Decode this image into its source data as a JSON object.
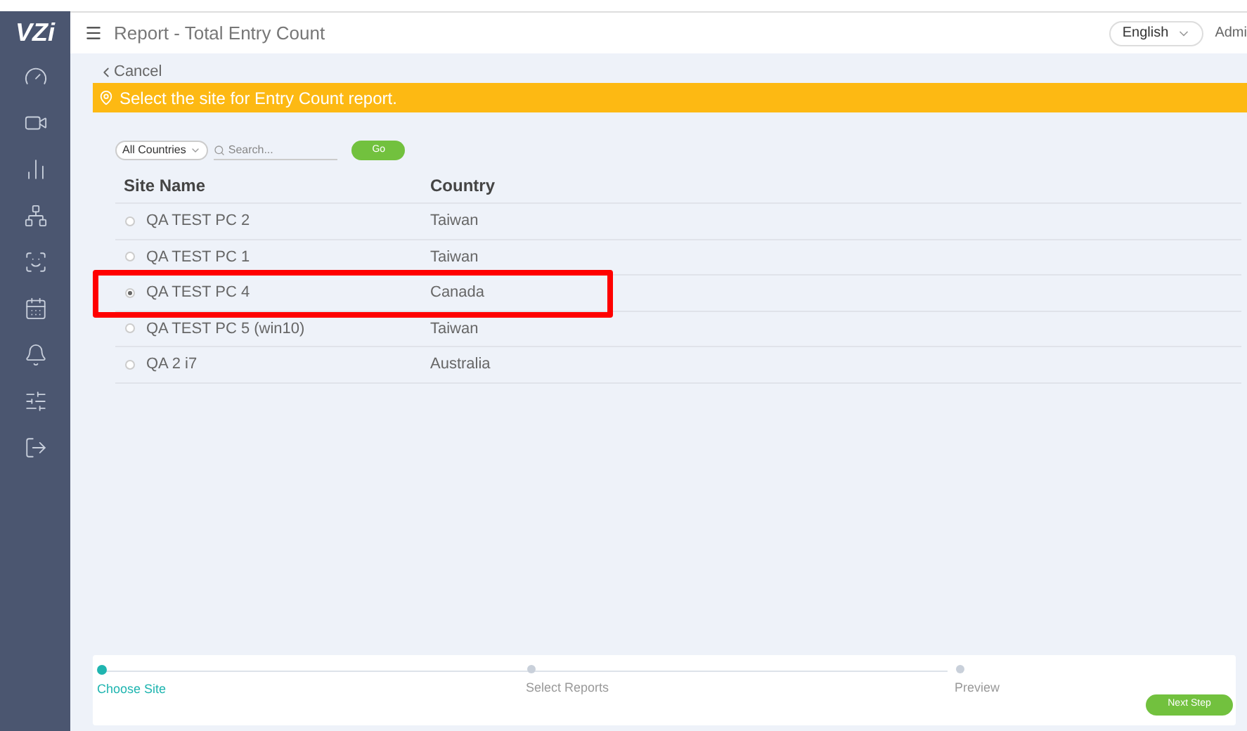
{
  "header": {
    "logo": "VZi",
    "title": "Report - Total Entry Count",
    "language": "English",
    "user": "Admi"
  },
  "cancel": "Cancel",
  "banner": "Select the site for Entry Count report.",
  "filter": {
    "country": "All Countries",
    "placeholder": "Search...",
    "go": "Go"
  },
  "table": {
    "columns": [
      "Site Name",
      "Country"
    ],
    "rows": [
      {
        "name": "QA TEST PC 2",
        "country": "Taiwan",
        "selected": false,
        "highlighted": false
      },
      {
        "name": "QA TEST PC 1",
        "country": "Taiwan",
        "selected": false,
        "highlighted": false
      },
      {
        "name": "QA TEST PC 4",
        "country": "Canada",
        "selected": true,
        "highlighted": true
      },
      {
        "name": "QA TEST PC 5 (win10)",
        "country": "Taiwan",
        "selected": false,
        "highlighted": false
      },
      {
        "name": "QA 2 i7",
        "country": "Australia",
        "selected": false,
        "highlighted": false
      }
    ]
  },
  "steps": [
    {
      "label": "Choose Site",
      "selected": true
    },
    {
      "label": "Select Reports",
      "selected": false
    },
    {
      "label": "Preview",
      "selected": false
    }
  ],
  "next": "Next Step"
}
